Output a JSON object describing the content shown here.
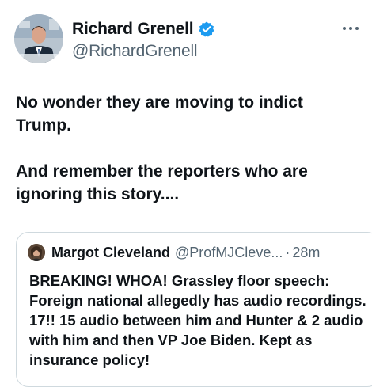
{
  "author": {
    "display_name": "Richard Grenell",
    "handle": "@RichardGrenell",
    "verified": true,
    "verified_color": "#1d9bf0"
  },
  "more_icon": "more-options-icon",
  "tweet": {
    "paragraphs": [
      "No wonder they are moving to indict Trump.",
      "And remember the reporters who are ignoring this story...."
    ]
  },
  "quoted": {
    "display_name": "Margot Cleveland",
    "handle": "@ProfMJCleve...",
    "separator": "·",
    "time": "28m",
    "text": "BREAKING!  WHOA! Grassley floor speech: Foreign national allegedly has audio recordings.  17!!  15 audio between him and Hunter & 2 audio with him and then VP Joe Biden.  Kept as insurance policy!"
  },
  "colors": {
    "text_primary": "#0f1419",
    "text_secondary": "#536471",
    "border": "#cfd9de"
  }
}
